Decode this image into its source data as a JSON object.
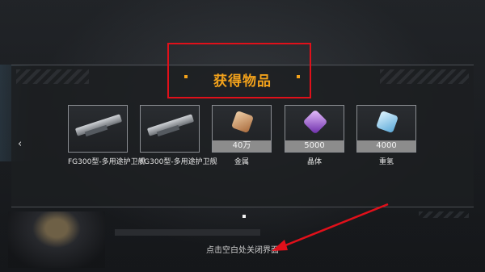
{
  "dialog": {
    "title": "获得物品",
    "prev_arrow": "‹",
    "close_hint": "点击空白处关闭界面"
  },
  "items": [
    {
      "name": "FG300型-多用途护卫舰",
      "quantity": "",
      "icon": "weapon-module-icon"
    },
    {
      "name": "FG300型-多用途护卫舰",
      "quantity": "",
      "icon": "weapon-module-icon"
    },
    {
      "name": "金属",
      "quantity": "40万",
      "icon": "metal-ore-icon"
    },
    {
      "name": "晶体",
      "quantity": "5000",
      "icon": "crystal-icon"
    },
    {
      "name": "重氢",
      "quantity": "4000",
      "icon": "deuterium-icon"
    }
  ],
  "colors": {
    "title": "#f3a21b",
    "highlight": "#e0101a",
    "arrow": "#e0101a"
  }
}
